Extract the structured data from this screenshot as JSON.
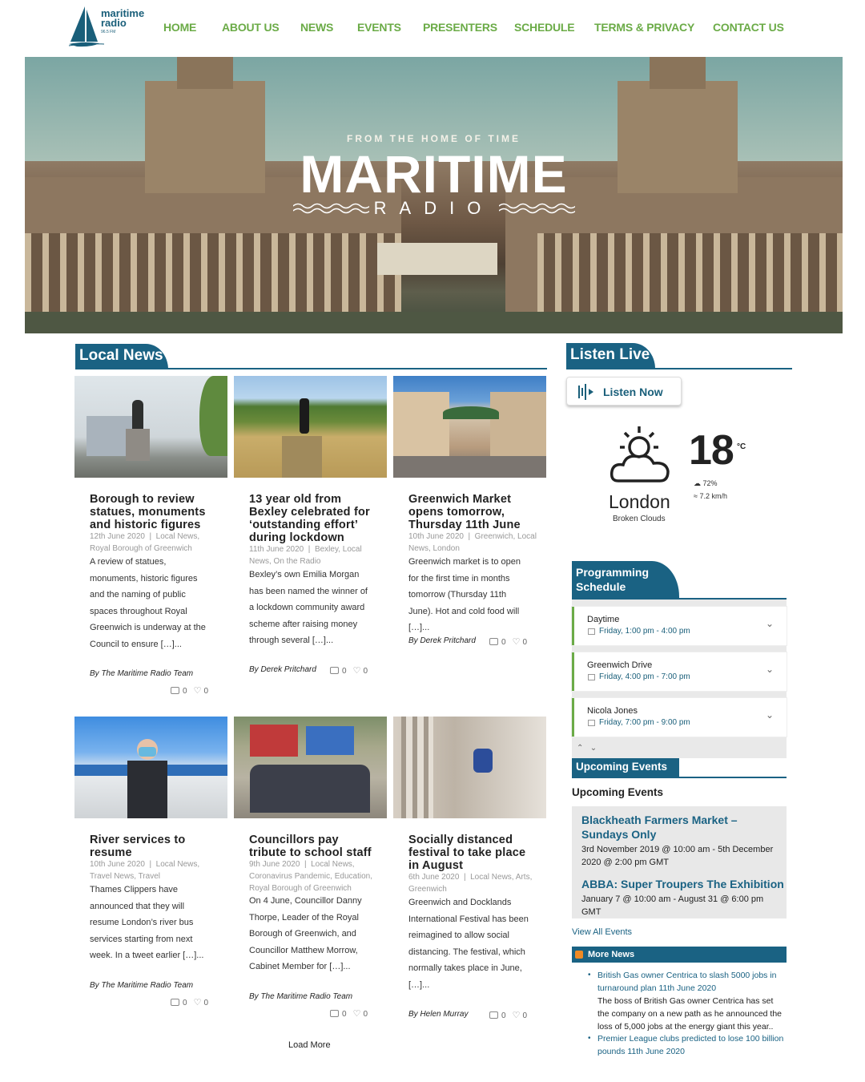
{
  "brand": {
    "name_line1": "maritime",
    "name_line2": "radio",
    "frequency": "96.5 FM"
  },
  "nav": [
    "HOME",
    "ABOUT US",
    "NEWS",
    "EVENTS",
    "PRESENTERS",
    "SCHEDULE",
    "TERMS & PRIVACY",
    "CONTACT US"
  ],
  "hero": {
    "tagline": "FROM THE HOME OF TIME",
    "title": "MARITIME",
    "subtitle": "RADIO"
  },
  "local_news": {
    "heading": "Local News",
    "load_more": "Load More",
    "articles": [
      {
        "title": "Borough to review statues, monuments and historic figures",
        "date": "12th June 2020",
        "cats": "Local News, Royal Borough of Greenwich",
        "excerpt": "A review of statues, monuments, historic figures and the naming of public spaces throughout Royal Greenwich is underway at the Council to ensure […]...",
        "author": "By The Maritime Radio Team",
        "comments": "0",
        "likes": "0"
      },
      {
        "title": "13 year old from Bexley celebrated for ‘outstanding effort’ during lockdown",
        "date": "11th June 2020",
        "cats": "Bexley, Local News, On the Radio",
        "excerpt": "Bexley’s own Emilia Morgan has been named the winner of a lockdown community award scheme after raising money through several […]...",
        "author": "By Derek Pritchard",
        "comments": "0",
        "likes": "0"
      },
      {
        "title": "Greenwich Market opens tomorrow, Thursday 11th June",
        "date": "10th June 2020",
        "cats": "Greenwich, Local News, London",
        "excerpt": "Greenwich market  is to open for the first time in months tomorrow (Thursday 11th June). Hot and cold food will […]...",
        "author": "By Derek Pritchard",
        "comments": "0",
        "likes": "0"
      },
      {
        "title": "River services to resume",
        "date": "10th June 2020",
        "cats": "Local News, Travel News, Travel",
        "excerpt": "Thames Clippers have announced that they will resume London’s river bus services starting from next week. In a tweet earlier […]...",
        "author": "By The Maritime Radio Team",
        "comments": "0",
        "likes": "0"
      },
      {
        "title": "Councillors pay tribute to school staff",
        "date": "9th June 2020",
        "cats": "Local News, Coronavirus Pandemic, Education, Royal Borough of Greenwich",
        "excerpt": "On 4 June, Councillor Danny Thorpe, Leader of the Royal Borough of Greenwich, and Councillor Matthew Morrow, Cabinet Member for […]...",
        "author": "By The Maritime Radio Team",
        "comments": "0",
        "likes": "0"
      },
      {
        "title": "Socially distanced festival to take place in August",
        "date": "6th June 2020",
        "cats": "Local News, Arts, Greenwich",
        "excerpt": "Greenwich and Docklands International Festival has been reimagined to allow social distancing. The festival, which normally takes place in June, […]...",
        "author": "By Helen Murray",
        "comments": "0",
        "likes": "0"
      }
    ]
  },
  "listen_live": {
    "heading": "Listen Live",
    "button": "Listen Now"
  },
  "weather": {
    "temp": "18",
    "unit": "°C",
    "humidity": "72%",
    "wind": "7.2 km/h",
    "city": "London",
    "conditions": "Broken Clouds"
  },
  "programming": {
    "heading_line1": "Programming",
    "heading_line2": "Schedule",
    "items": [
      {
        "name": "Daytime",
        "time": "Friday, 1:00 pm - 4:00 pm"
      },
      {
        "name": "Greenwich Drive",
        "time": "Friday, 4:00 pm - 7:00 pm"
      },
      {
        "name": "Nicola Jones",
        "time": "Friday, 7:00 pm - 9:00 pm"
      }
    ]
  },
  "upcoming_events": {
    "tab": "Upcoming Events",
    "heading": "Upcoming Events",
    "events": [
      {
        "title": "Blackheath Farmers Market – Sundays Only",
        "date": "3rd November 2019 @ 10:00 am - 5th December 2020 @ 2:00 pm GMT"
      },
      {
        "title": "ABBA: Super Troupers The Exhibition",
        "date": "January 7 @ 10:00 am - August 31 @ 6:00 pm GMT"
      }
    ],
    "view_all": "View All Events"
  },
  "more_news": {
    "heading": "More News",
    "items": [
      {
        "link": "British Gas owner Centrica to slash 5000 jobs in turnaround plan 11th June 2020",
        "body": "The boss of British Gas owner Centrica has set the company on a new path as he announced the loss of 5,000 jobs at the energy giant this year.."
      },
      {
        "link": "Premier League clubs predicted to lose 100 billion pounds 11th June 2020",
        "body": ""
      }
    ]
  },
  "colors": {
    "accent_green": "#6bab47",
    "brand_blue": "#1a6283"
  }
}
